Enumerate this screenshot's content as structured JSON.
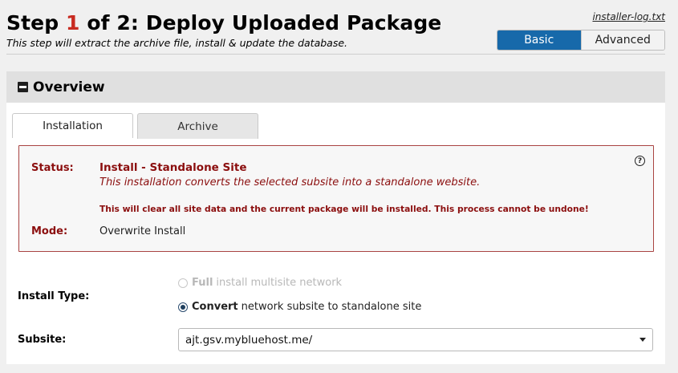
{
  "header": {
    "title_prefix": "Step ",
    "step_number": "1",
    "title_suffix": " of 2: Deploy Uploaded Package",
    "subtitle": "This step will extract the archive file, install & update the database.",
    "log_link": "installer-log.txt",
    "mode_basic": "Basic",
    "mode_advanced": "Advanced",
    "accent_color": "#c82b21",
    "active_mode_color": "#1769aa"
  },
  "overview": {
    "title": "Overview",
    "tabs": [
      {
        "label": "Installation",
        "active": true
      },
      {
        "label": "Archive",
        "active": false
      }
    ],
    "status_label": "Status:",
    "status_value": "Install - Standalone Site",
    "status_description": "This installation converts the selected subsite into a standalone website.",
    "warning": "This will clear all site data and the current package will be installed. This process cannot be undone!",
    "mode_label": "Mode:",
    "mode_value": "Overwrite Install",
    "status_color": "#8b0e0e"
  },
  "form": {
    "install_type_label": "Install Type:",
    "option_full_bold": "Full",
    "option_full_rest": "install multisite network",
    "option_convert_bold": "Convert",
    "option_convert_rest": "network subsite to standalone site",
    "subsite_label": "Subsite:",
    "subsite_value": "ajt.gsv.mybluehost.me/"
  }
}
